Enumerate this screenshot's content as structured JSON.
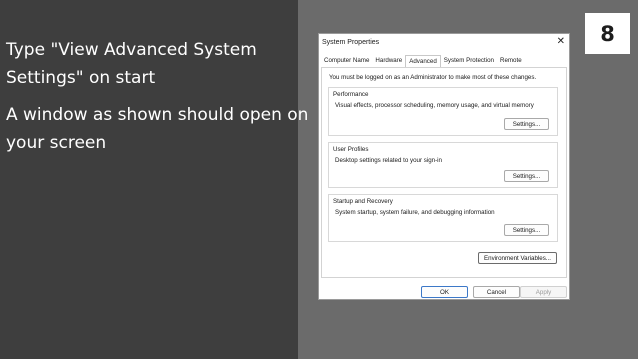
{
  "slide": {
    "step_number": "8",
    "paragraph1_line1": "Type \"View Advanced System",
    "paragraph1_line2": "Settings\" on start",
    "paragraph2_line1": "A window as shown should open on",
    "paragraph2_line2": "your screen",
    "left_bg": "#3e3e3e",
    "right_bg": "#6b6b6b"
  },
  "dialog": {
    "title": "System Properties",
    "close_glyph": "✕",
    "tabs": [
      "Computer Name",
      "Hardware",
      "Advanced",
      "System Protection",
      "Remote"
    ],
    "active_tab": "Advanced",
    "admin_note": "You must be logged on as an Administrator to make most of these changes.",
    "groups": {
      "performance": {
        "title": "Performance",
        "description": "Visual effects, processor scheduling, memory usage, and virtual memory",
        "button": "Settings..."
      },
      "user_profiles": {
        "title": "User Profiles",
        "description": "Desktop settings related to your sign-in",
        "button": "Settings..."
      },
      "startup_recovery": {
        "title": "Startup and Recovery",
        "description": "System startup, system failure, and debugging information",
        "button": "Settings..."
      }
    },
    "env_button": "Environment Variables...",
    "footer": {
      "ok": "OK",
      "cancel": "Cancel",
      "apply": "Apply"
    }
  }
}
